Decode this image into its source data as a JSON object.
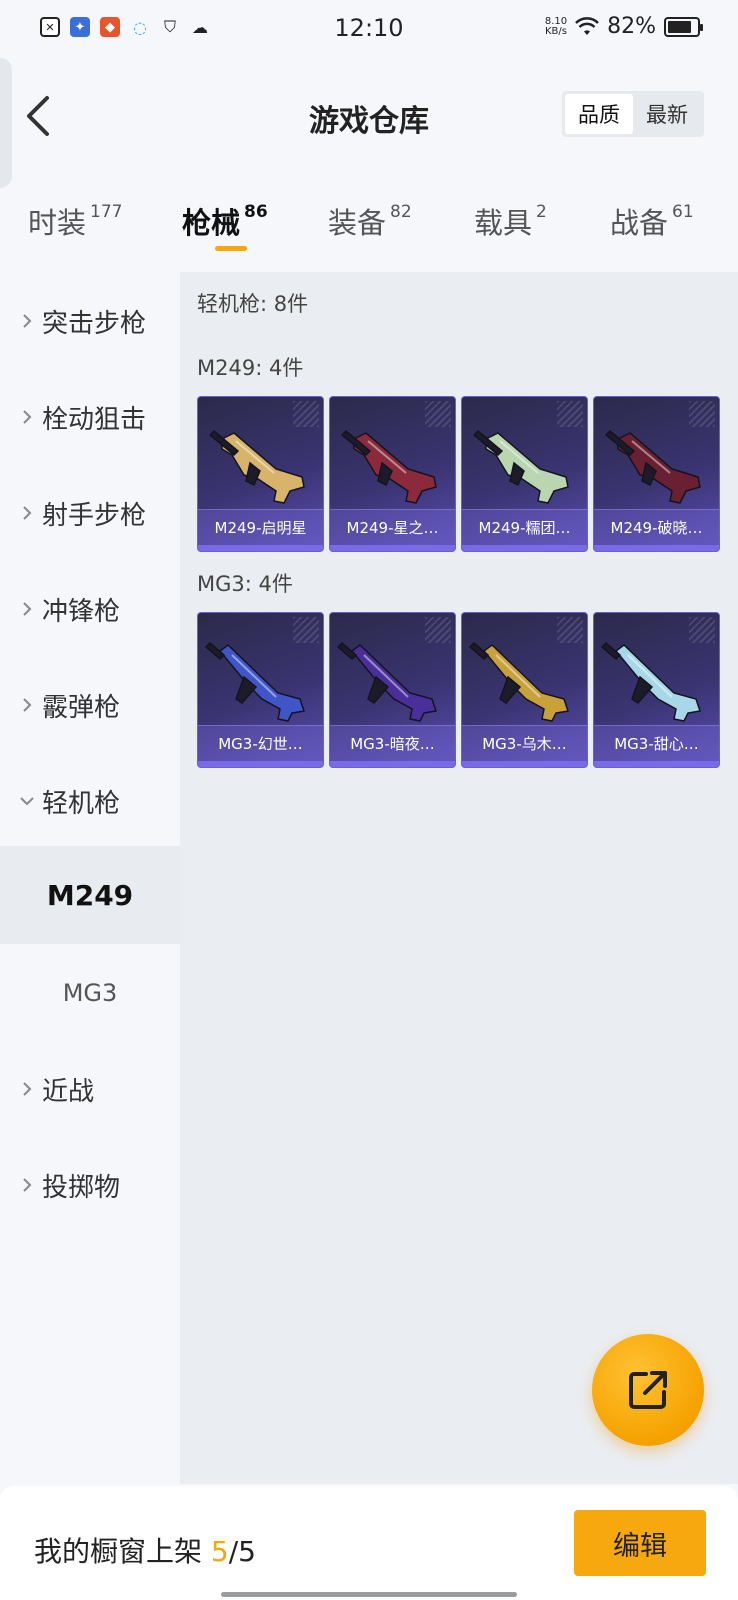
{
  "status_bar": {
    "time": "12:10",
    "net_speed_value": "8.10",
    "net_speed_unit": "KB/s",
    "battery_percent": "82%",
    "battery_level": 0.82
  },
  "header": {
    "title": "游戏仓库",
    "sort_options": [
      "品质",
      "最新"
    ],
    "sort_selected": "品质"
  },
  "tabs": [
    {
      "label": "时装",
      "count": "177",
      "active": false
    },
    {
      "label": "枪械",
      "count": "86",
      "active": true
    },
    {
      "label": "装备",
      "count": "82",
      "active": false
    },
    {
      "label": "载具",
      "count": "2",
      "active": false
    },
    {
      "label": "战备",
      "count": "61",
      "active": false
    }
  ],
  "sidebar": {
    "items": [
      {
        "label": "突击步枪",
        "expanded": false
      },
      {
        "label": "栓动狙击",
        "expanded": false
      },
      {
        "label": "射手步枪",
        "expanded": false
      },
      {
        "label": "冲锋枪",
        "expanded": false
      },
      {
        "label": "霰弹枪",
        "expanded": false
      },
      {
        "label": "轻机枪",
        "expanded": true
      }
    ],
    "subitems": [
      {
        "label": "M249",
        "active": true
      },
      {
        "label": "MG3",
        "active": false
      }
    ],
    "items_after": [
      {
        "label": "近战",
        "expanded": false
      },
      {
        "label": "投掷物",
        "expanded": false
      }
    ]
  },
  "main": {
    "category_summary": "轻机枪: 8件",
    "groups": [
      {
        "title": "M249: 4件",
        "cards": [
          {
            "label": "M249-启明星",
            "icon": "m249-gold-gun-icon",
            "color": "#d8b36a"
          },
          {
            "label": "M249-星之…",
            "icon": "m249-red-gun-icon",
            "color": "#8a2a3a"
          },
          {
            "label": "M249-糯团…",
            "icon": "m249-green-gun-icon",
            "color": "#b9d6b0"
          },
          {
            "label": "M249-破晓…",
            "icon": "m249-dark-red-gun-icon",
            "color": "#6a2030"
          }
        ]
      },
      {
        "title": "MG3: 4件",
        "cards": [
          {
            "label": "MG3-幻世…",
            "icon": "mg3-blue-gold-gun-icon",
            "color": "#3f55c8"
          },
          {
            "label": "MG3-暗夜…",
            "icon": "mg3-purple-gun-icon",
            "color": "#4a2f9a"
          },
          {
            "label": "MG3-乌木…",
            "icon": "mg3-gold-gun-icon",
            "color": "#c9a13a"
          },
          {
            "label": "MG3-甜心…",
            "icon": "mg3-pastel-gun-icon",
            "color": "#a8d8e8"
          }
        ]
      }
    ]
  },
  "bottom": {
    "shelf_label": "我的橱窗上架",
    "shelf_current": "5",
    "shelf_total": "/5",
    "edit_label": "编辑"
  },
  "colors": {
    "accent": "#f5a70f",
    "card_bg": "#3a3472"
  }
}
